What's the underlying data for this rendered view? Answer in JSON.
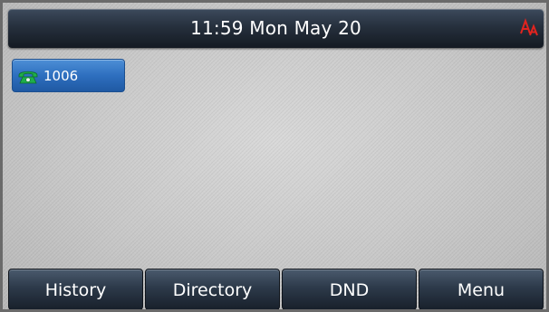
{
  "status_bar": {
    "datetime": "11:59 Mon May 20",
    "font_size_icon": "font-size-AA-icon",
    "font_size_icon_color": "#e0241f"
  },
  "line_key": {
    "label": "1006",
    "icon": "phone-handset-icon",
    "icon_color": "#1fae4a"
  },
  "softkeys": [
    {
      "label": "History"
    },
    {
      "label": "Directory"
    },
    {
      "label": "DND"
    },
    {
      "label": "Menu"
    }
  ],
  "colors": {
    "accent_blue": "#2e6fbf",
    "bar_dark": "#26303d"
  }
}
